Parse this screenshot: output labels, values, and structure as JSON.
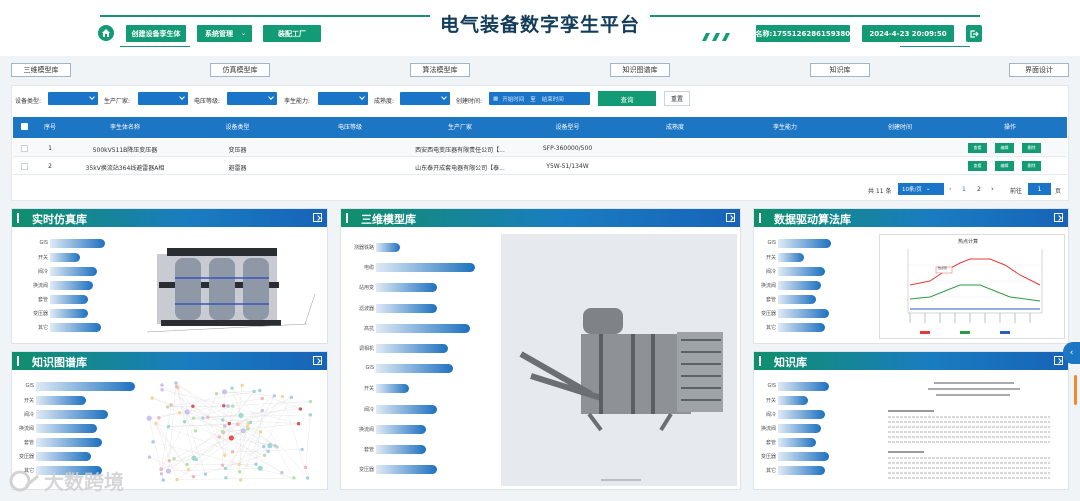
{
  "header": {
    "title": "电气装备数字孪生平台",
    "btn_create": "创建设备孪生体",
    "btn_system": "系统管理",
    "btn_factory": "装配工厂",
    "user_name": "•名称:17551262861593806",
    "datetime": "2024-4-23 20:09:50"
  },
  "nav_tabs": [
    "三维模型库",
    "仿真模型库",
    "算法模型库",
    "知识图谱库",
    "知识库",
    "界面设计"
  ],
  "filters": {
    "device_type": "设备类型:",
    "manufacturer": "生产厂家:",
    "voltage": "电压等级:",
    "twin_ability": "孪生能力:",
    "maturity": "成熟度:",
    "create_time": "创建时间:",
    "start_placeholder": "开始时间",
    "range_sep": "至",
    "end_placeholder": "结束时间",
    "query": "查询",
    "reset": "重置"
  },
  "table": {
    "headers": [
      "序号",
      "孪生体名称",
      "设备类型",
      "电压等级",
      "生产厂家",
      "设备型号",
      "成熟度",
      "孪生能力",
      "创建时间",
      "操作"
    ],
    "rows": [
      [
        "1",
        "500kV511B降压变压器",
        "变压器",
        "",
        "西安西电变压器有限责任公司【...",
        "SFP-360000/500",
        "",
        "",
        "",
        ""
      ],
      [
        "2",
        "35kV换流站364线避雷器A相",
        "避雷器",
        "",
        "山东泰开成套电器有限公司【泰...",
        "Y5W-51/134W",
        "",
        "",
        "",
        ""
      ]
    ],
    "op_labels": [
      "查看",
      "编辑",
      "删除"
    ]
  },
  "pagination": {
    "total": "共 11 条",
    "page_size": "10条/页",
    "pages": [
      "1",
      "2"
    ],
    "goto": "前往",
    "current": "1",
    "page_suffix": "页"
  },
  "cards": {
    "sim": {
      "title": "实时仿真库",
      "labels": [
        "GIS",
        "开关",
        "阀冷",
        "换流阀",
        "套管",
        "变压器",
        "其它"
      ],
      "values": [
        0.65,
        0.35,
        0.55,
        0.5,
        0.45,
        0.45,
        0.6
      ]
    },
    "model3d": {
      "title": "三维模型库",
      "labels": [
        "测器铁路",
        "电缆",
        "站用变",
        "滤波器",
        "高抗",
        "调相机",
        "GIS",
        "开关",
        "阀冷",
        "换流阀",
        "套管",
        "变压器"
      ],
      "values": [
        0.22,
        0.9,
        0.55,
        0.55,
        0.85,
        0.65,
        0.7,
        0.3,
        0.55,
        0.45,
        0.45,
        0.55
      ]
    },
    "algo": {
      "title": "数据驱动算法库",
      "labels": [
        "GIS",
        "开关",
        "阀冷",
        "换流阀",
        "套管",
        "变压器",
        "其它"
      ],
      "values": [
        0.62,
        0.3,
        0.55,
        0.5,
        0.45,
        0.6,
        0.55
      ]
    },
    "graph": {
      "title": "知识图谱库",
      "labels": [
        "GIS",
        "开关",
        "阀冷",
        "换流阀",
        "套管",
        "变压器",
        "其它"
      ],
      "values": [
        0.9,
        0.45,
        0.65,
        0.55,
        0.6,
        0.5,
        0.6
      ]
    },
    "kb": {
      "title": "知识库",
      "labels": [
        "GIS",
        "开关",
        "阀冷",
        "换流阀",
        "套管",
        "变压器",
        "其它"
      ],
      "values": [
        0.6,
        0.35,
        0.55,
        0.5,
        0.45,
        0.6,
        0.55
      ]
    }
  },
  "algo_chart": {
    "title": "热点计算",
    "tag": "热点值"
  },
  "watermark": "大数跨境"
}
